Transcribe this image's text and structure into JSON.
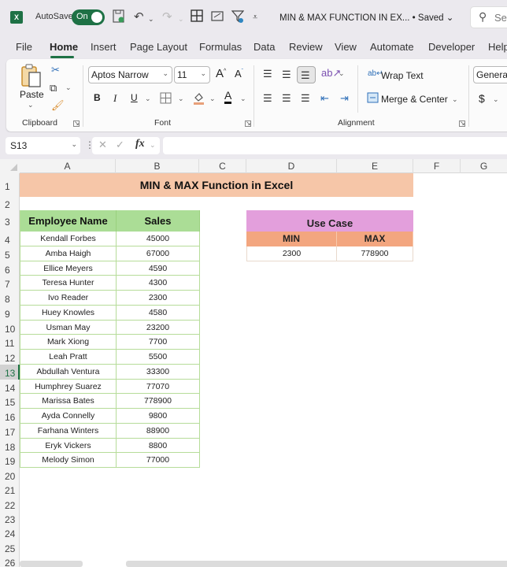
{
  "titlebar": {
    "app_icon": "excel-logo-icon",
    "app_letter": "X",
    "autosave_label": "AutoSave",
    "autosave_state": "On",
    "document_title": "MIN & MAX FUNCTION IN EX... • Saved",
    "title_chevron": "⌄",
    "search_placeholder": "Se",
    "quick_access_icons": [
      "save-icon",
      "undo-icon",
      "redo-icon",
      "borders-icon",
      "form-icon",
      "filter-icon",
      "customize-qat-icon"
    ]
  },
  "ribbon_tabs": [
    {
      "label": "File",
      "active": false
    },
    {
      "label": "Home",
      "active": true
    },
    {
      "label": "Insert",
      "active": false
    },
    {
      "label": "Page Layout",
      "active": false
    },
    {
      "label": "Formulas",
      "active": false
    },
    {
      "label": "Data",
      "active": false
    },
    {
      "label": "Review",
      "active": false
    },
    {
      "label": "View",
      "active": false
    },
    {
      "label": "Automate",
      "active": false
    },
    {
      "label": "Developer",
      "active": false
    },
    {
      "label": "Help",
      "active": false
    }
  ],
  "ribbon": {
    "clipboard": {
      "paste_label": "Paste",
      "group_label": "Clipboard"
    },
    "font": {
      "font_name": "Aptos Narrow",
      "font_size": "11",
      "bold": "B",
      "italic": "I",
      "underline": "U",
      "grow": "A",
      "shrink": "A",
      "font_color": "A",
      "group_label": "Font"
    },
    "alignment": {
      "wrap_text": "Wrap Text",
      "merge_center": "Merge & Center",
      "group_label": "Alignment"
    },
    "number": {
      "format": "General",
      "currency": "$"
    }
  },
  "formula_bar": {
    "name_box": "S13",
    "fx_label": "fx",
    "formula": ""
  },
  "columns": [
    "A",
    "B",
    "C",
    "D",
    "E",
    "F",
    "G"
  ],
  "rows": [
    "1",
    "2",
    "3",
    "4",
    "5",
    "6",
    "7",
    "8",
    "9",
    "10",
    "11",
    "12",
    "13",
    "14",
    "15",
    "16",
    "17",
    "18",
    "19",
    "20",
    "21",
    "22",
    "23",
    "24",
    "25",
    "26"
  ],
  "selected_row": "13",
  "sheet": {
    "title": "MIN & MAX Function in Excel",
    "employee_table": {
      "headers": [
        "Employee Name",
        "Sales"
      ],
      "rows": [
        [
          "Kendall Forbes",
          "45000"
        ],
        [
          "Amba Haigh",
          "67000"
        ],
        [
          "Ellice Meyers",
          "4590"
        ],
        [
          "Teresa Hunter",
          "4300"
        ],
        [
          "Ivo Reader",
          "2300"
        ],
        [
          "Huey Knowles",
          "4580"
        ],
        [
          "Usman May",
          "23200"
        ],
        [
          "Mark Xiong",
          "7700"
        ],
        [
          "Leah Pratt",
          "5500"
        ],
        [
          "Abdullah Ventura",
          "33300"
        ],
        [
          "Humphrey Suarez",
          "77070"
        ],
        [
          "Marissa Bates",
          "778900"
        ],
        [
          "Ayda Connelly",
          "9800"
        ],
        [
          "Farhana Winters",
          "88900"
        ],
        [
          "Eryk Vickers",
          "8800"
        ],
        [
          "Melody Simon",
          "77000"
        ]
      ]
    },
    "use_case": {
      "title": "Use Case",
      "headers": [
        "MIN",
        "MAX"
      ],
      "values": [
        "2300",
        "778900"
      ]
    }
  },
  "colors": {
    "excel_green": "#1e7145",
    "title_fill": "#f6c6a8",
    "header_green": "#abdd96",
    "use_case_purple": "#e39fdc",
    "min_max_orange": "#f3a67f"
  }
}
